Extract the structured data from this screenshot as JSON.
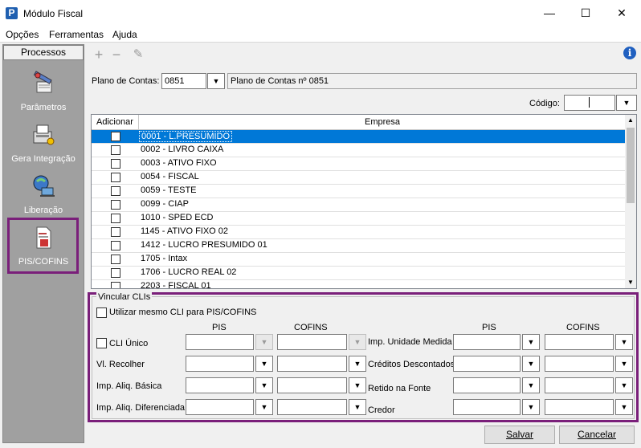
{
  "window": {
    "title": "Módulo Fiscal",
    "app_icon": "P",
    "minimize": "—",
    "maximize": "☐",
    "close": "✕"
  },
  "menu": [
    "Opções",
    "Ferramentas",
    "Ajuda"
  ],
  "sidebar": {
    "header": "Processos",
    "items": [
      {
        "label": "Parâmetros",
        "icon": "parameters-icon"
      },
      {
        "label": "Gera Integração",
        "icon": "integration-icon"
      },
      {
        "label": "Liberação",
        "icon": "release-icon"
      },
      {
        "label": "PIS/COFINS",
        "icon": "pis-cofins-icon"
      }
    ]
  },
  "toolbar": {
    "add": "+",
    "remove": "−",
    "edit": "✎",
    "info": "i"
  },
  "plano": {
    "label": "Plano de Contas:",
    "value": "0851",
    "description": "Plano de Contas nº 0851"
  },
  "codigo": {
    "label": "Código:",
    "value": ""
  },
  "grid": {
    "headers": {
      "add": "Adicionar",
      "company": "Empresa"
    },
    "rows": [
      "0001 - L.PRESUMIDO",
      "0002 - LIVRO CAIXA",
      "0003 - ATIVO FIXO",
      "0054 - FISCAL",
      "0059 - TESTE",
      "0099 - CIAP",
      "1010 - SPED ECD",
      "1145 - ATIVO FIXO 02",
      "1412 - LUCRO PRESUMIDO 01",
      "1705 - Intax",
      "1706 - LUCRO REAL 02",
      "2203 - FISCAL 01"
    ],
    "selected_index": 0
  },
  "vincular": {
    "title": "Vincular CLIs",
    "same_cli_label": "Utilizar mesmo CLI para PIS/COFINS",
    "col_pis": "PIS",
    "col_cofins": "COFINS",
    "left_rows": [
      "CLI Único",
      "Vl. Recolher",
      "Imp. Aliq. Básica",
      "Imp. Aliq. Diferenciada"
    ],
    "right_rows": [
      "Imp. Unidade Medida",
      "Créditos Descontados",
      "Retido na Fonte",
      "Credor"
    ]
  },
  "buttons": {
    "save": "Salvar",
    "cancel": "Cancelar"
  }
}
